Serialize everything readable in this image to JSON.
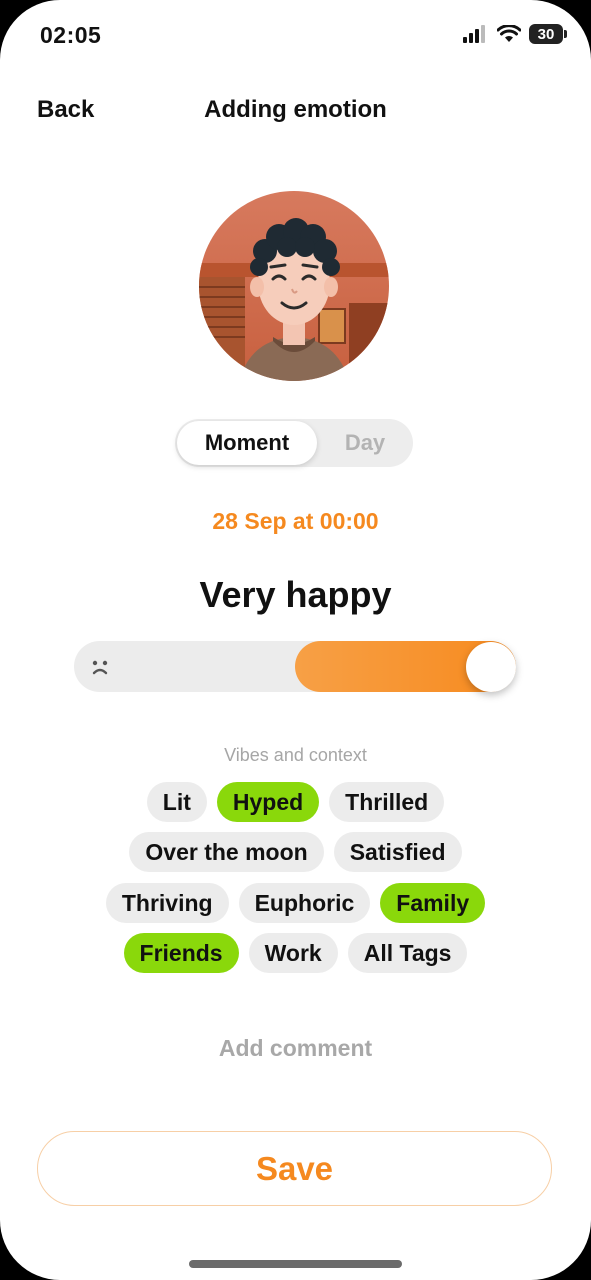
{
  "status_bar": {
    "time": "02:05",
    "battery": "30",
    "icons": [
      "signal-icon",
      "wifi-icon",
      "battery-icon"
    ]
  },
  "header": {
    "back_label": "Back",
    "title": "Adding emotion"
  },
  "avatar": {
    "description_icon": "avatar"
  },
  "mode_toggle": {
    "options": [
      "Moment",
      "Day"
    ],
    "selected": "Moment"
  },
  "date_label": "28 Sep at 00:00",
  "mood": {
    "label": "Very happy",
    "slider_value": 1.0,
    "left_icon": "sad-face-icon",
    "fill_color": "#f78a1e"
  },
  "vibes": {
    "heading": "Vibes and context",
    "tags": [
      {
        "label": "Lit",
        "selected": false
      },
      {
        "label": "Hyped",
        "selected": true
      },
      {
        "label": "Thrilled",
        "selected": false
      },
      {
        "label": "Over the moon",
        "selected": false
      },
      {
        "label": "Satisfied",
        "selected": false
      },
      {
        "label": "Thriving",
        "selected": false
      },
      {
        "label": "Euphoric",
        "selected": false
      },
      {
        "label": "Family",
        "selected": true
      },
      {
        "label": "Friends",
        "selected": true
      },
      {
        "label": "Work",
        "selected": false
      },
      {
        "label": "All Tags",
        "selected": false
      }
    ],
    "selected_color": "#8ad80b"
  },
  "comment_placeholder": "Add comment",
  "save_label": "Save",
  "colors": {
    "accent": "#f5891f",
    "tag_selected": "#8ad80b",
    "tag_default": "#ececec"
  }
}
